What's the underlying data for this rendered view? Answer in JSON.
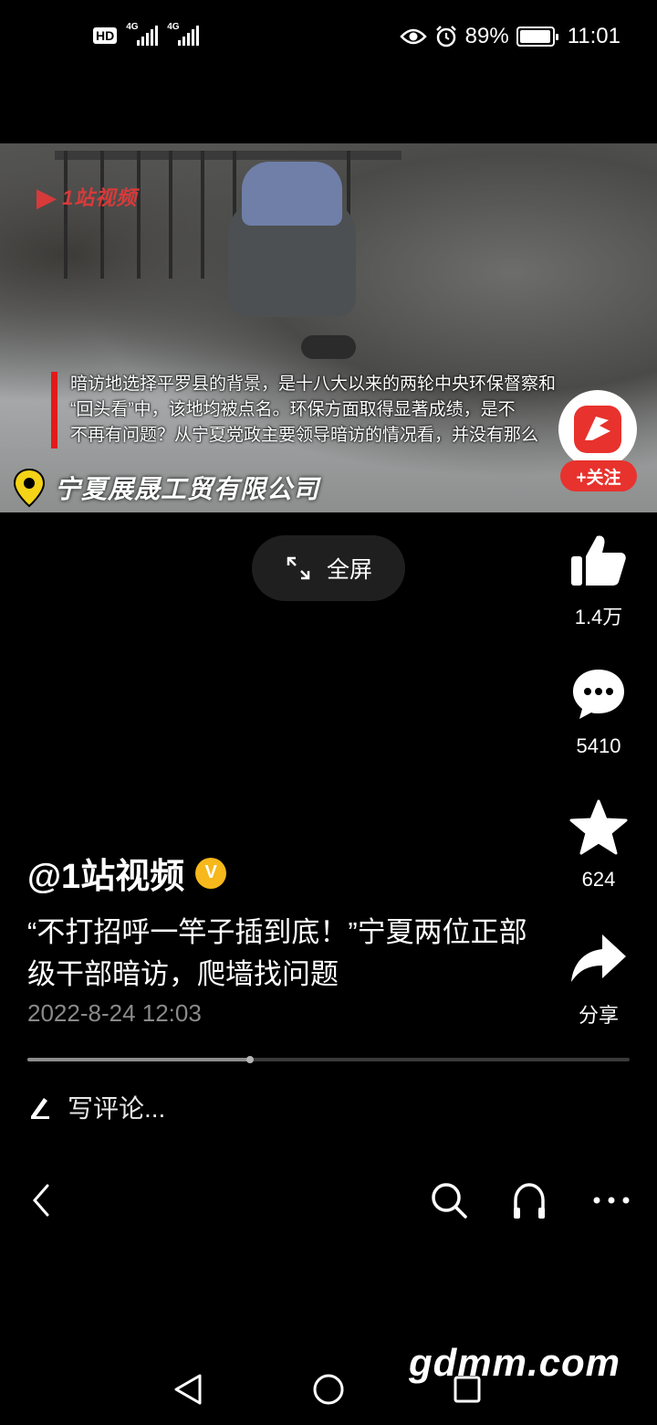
{
  "status_bar": {
    "hd": "HD",
    "sim1_tag": "4G",
    "sim2_tag": "4G",
    "battery": "89%",
    "time": "11:01"
  },
  "video": {
    "logo_text": "1站视频",
    "caption_line1": "暗访地选择平罗县的背景，是十八大以来的两轮中央环保督察和",
    "caption_line2": "“回头看”中，该地均被点名。环保方面取得显著成绩，是不",
    "caption_line3": "不再有问题？从宁夏党政主要领导暗访的情况看，并没有那么",
    "location": "宁夏展晟工贸有限公司",
    "follow_label": "+关注"
  },
  "fullscreen_label": "全屏",
  "actions": {
    "like_count": "1.4万",
    "comment_count": "5410",
    "favorite_count": "624",
    "share_label": "分享"
  },
  "post": {
    "author": "@1站视频",
    "verified_badge": "V",
    "title": "“不打招呼一竿子插到底！”宁夏两位正部级干部暗访，爬墙找问题",
    "date": "2022-8-24 12:03",
    "progress": 0.37
  },
  "comment_placeholder": "写评论...",
  "watermark": "gdmm.com"
}
